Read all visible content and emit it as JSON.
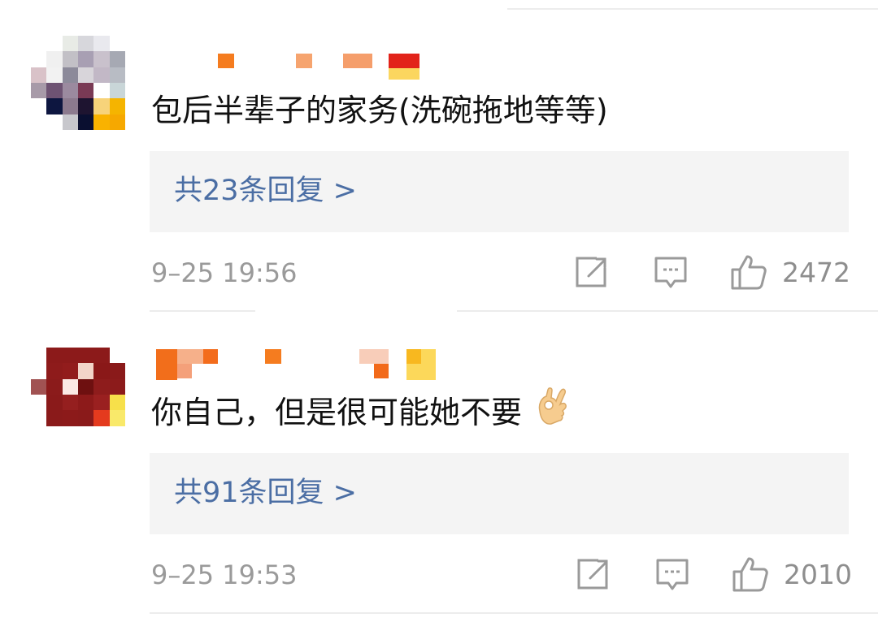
{
  "comments": [
    {
      "text": "包后半辈子的家务(洗碗拖地等等)",
      "replies_label": "共23条回复 >",
      "timestamp": "9–25 19:56",
      "like_count": "2472",
      "has_emoji": false
    },
    {
      "text": "你自己，但是很可能她不要",
      "replies_label": "共91条回复 >",
      "timestamp": "9–25 19:53",
      "like_count": "2010",
      "has_emoji": true,
      "emoji_icon": "ok-hand-icon"
    }
  ],
  "icons": {
    "repost": "share-edit-icon",
    "comment": "comment-icon",
    "like": "thumbs-up-icon"
  },
  "colors": {
    "reply_link": "#4b6ea4",
    "meta_text": "#9a9a9a",
    "reply_box_bg": "#f4f4f4",
    "icon_stroke": "#9a9a9a"
  }
}
